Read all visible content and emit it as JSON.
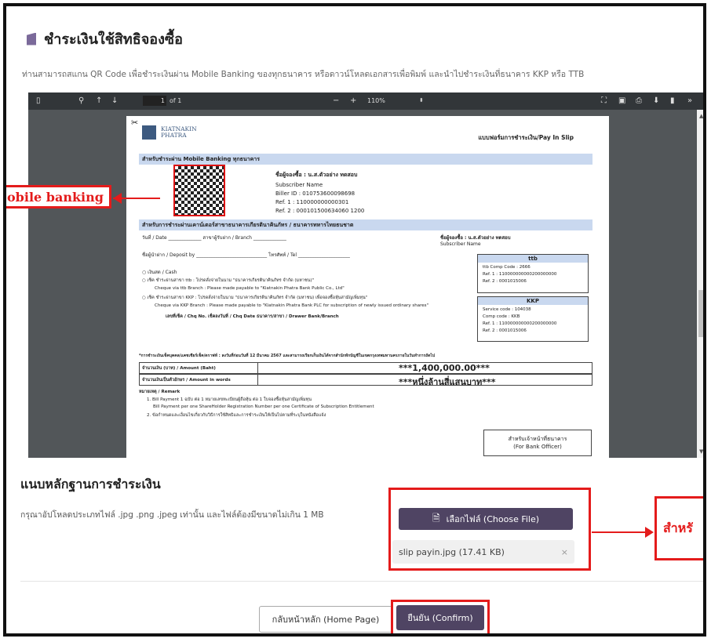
{
  "page_title": "ชำระเงินใช้สิทธิจองซื้อ",
  "description": "ท่านสามารถสแกน QR Code เพื่อชำระเงินผ่าน Mobile Banking ของทุกธนาคาร หรือดาวน์โหลดเอกสารเพื่อพิมพ์ และนำไปชำระเงินที่ธนาคาร KKP หรือ TTB",
  "pdf_toolbar": {
    "page_number": "1",
    "page_count": "of 1",
    "zoom": "110%",
    "minus": "−",
    "plus": "+"
  },
  "pdf_page": {
    "bank_name": "KIATNAKIN\nPHATRA",
    "slip_title": "แบบฟอร์มการชำระเงิน/Pay In Slip",
    "mobile_band": "สำหรับชำระผ่าน Mobile Banking ทุกธนาคาร",
    "subscriber_label": "ชื่อผู้จองซื้อ : น.ส.ตัวอย่าง ทดสอบ",
    "subscriber_name_en": "Subscriber Name",
    "biller_id": "Biller ID : 010753600098698",
    "ref1": "Ref. 1 : 110000000000301",
    "ref2": "Ref. 2 : 000101500634060 1200",
    "counter_band": "สำหรับการชำระผ่านเคาน์เตอร์สาขาธนาคารเกียรตินาคินภัทร / ธนาคารทหารไทยธนชาต",
    "date_line": "วันที่ / Date ______________ สาขาผู้รับฝาก / Branch ______________",
    "depositor_line": "ชื่อผู้นำฝาก / Deposit by ______________________________ โทรศัพท์ / Tel ______________________",
    "cash": "○ เงินสด / Cash",
    "cheque_ttb": "○ เช็ค ชำระผ่านสาขา ttb : โปรดสั่งจ่ายในนาม \"ธนาคารเกียรตินาคินภัทร จำกัด (มหาชน)\"",
    "cheque_ttb_en": "Cheque via ttb Branch : Please made payable to \"Kiatnakin Phatra Bank Public Co., Ltd\"",
    "cheque_kkp": "○ เช็ค ชำระผ่านสาขา KKP : โปรดสั่งจ่ายในนาม \"ธนาคารเกียรตินาคินภัทร จำกัด (มหาชน) เพื่อจองซื้อหุ้นสามัญเพิ่มทุน\"",
    "cheque_kkp_en": "Cheque via KKP Branch : Please made payable to \"Kiatnakin Phatra Bank PLC for subscription of newly issued ordinary shares\"",
    "cheque_cols": "เลขที่เช็ค / Chq No.    เช็คลงวันที่ / Chq Date       ธนาคาร/สาขา / Drawer Bank/Branch",
    "ttb_box": {
      "head": "ttb",
      "line1": "ttb Comp Code : 2666",
      "line2": "Ref. 1 : 110000000000200000000",
      "line3": "Ref. 2 : 0001015006"
    },
    "kkp_box": {
      "head": "KKP",
      "line1": "Service code : 104038",
      "line2": "Comp code : KKB",
      "line3": "Ref. 1 : 110000000000200000000",
      "line4": "Ref. 2 : 0001015006"
    },
    "deadline_note": "*การชำระเงินเช็คบุคคล/แคชเชียร์เช็ค/ดราฟท์ : ลงวันที่ก่อนวันที่ 12 มีนาคม 2567 และสามารถเรียกเก็บเงินได้จากสำนักหักบัญชีในเขตกรุงเทพมหานครภายในวันทำการถัดไป",
    "amount_label": "จำนวนเงิน (บาท) / Amount (Baht)",
    "amount_value": "***1,400,000.00***",
    "words_label": "จำนวนเงินเป็นตัวอักษร / Amount in words",
    "words_value": "***หนึ่งล้านสี่แสนบาท***",
    "remark": "หมายเหตุ / Remark",
    "remark1": "1. Bill Payment 1 ฉบับ ต่อ 1 หมายเลขทะเบียนผู้ถือหุ้น ต่อ 1 ใบจองซื้อหุ้นสามัญเพิ่มทุน",
    "remark1_en": "Bill Payment per one ShareHolder Registration Number per one Certificate of Subscription Entitlement",
    "remark2": "2. ข้อกำหนดและเงื่อนไขเกี่ยวกับวิธีการใช้สิทธิและการชำระเงินให้เป็นไปตามที่ระบุในหนังสือแจ้ง",
    "officer": "สำหรับเจ้าหน้าที่ธนาคาร\n(For Bank Officer)"
  },
  "callout_left": "obile banking",
  "section_title": "แนบหลักฐานการชำระเงิน",
  "upload_hint": "กรุณาอัปโหลดประเภทไฟล์ .jpg .png .jpeg เท่านั้น และไฟล์ต้องมีขนาดไม่เกิน 1 MB",
  "choose_file_label": "เลือกไฟล์ (Choose File)",
  "file_name": "slip payin.jpg (17.41 KB)",
  "remove_icon": "×",
  "callout_right": "สำหรั",
  "home_button": "กลับหน้าหลัก (Home Page)",
  "confirm_button": "ยืนยัน (Confirm)",
  "colors": {
    "accent": "#4f4463",
    "highlight": "#e41b1b",
    "band": "#c9d8ef"
  }
}
